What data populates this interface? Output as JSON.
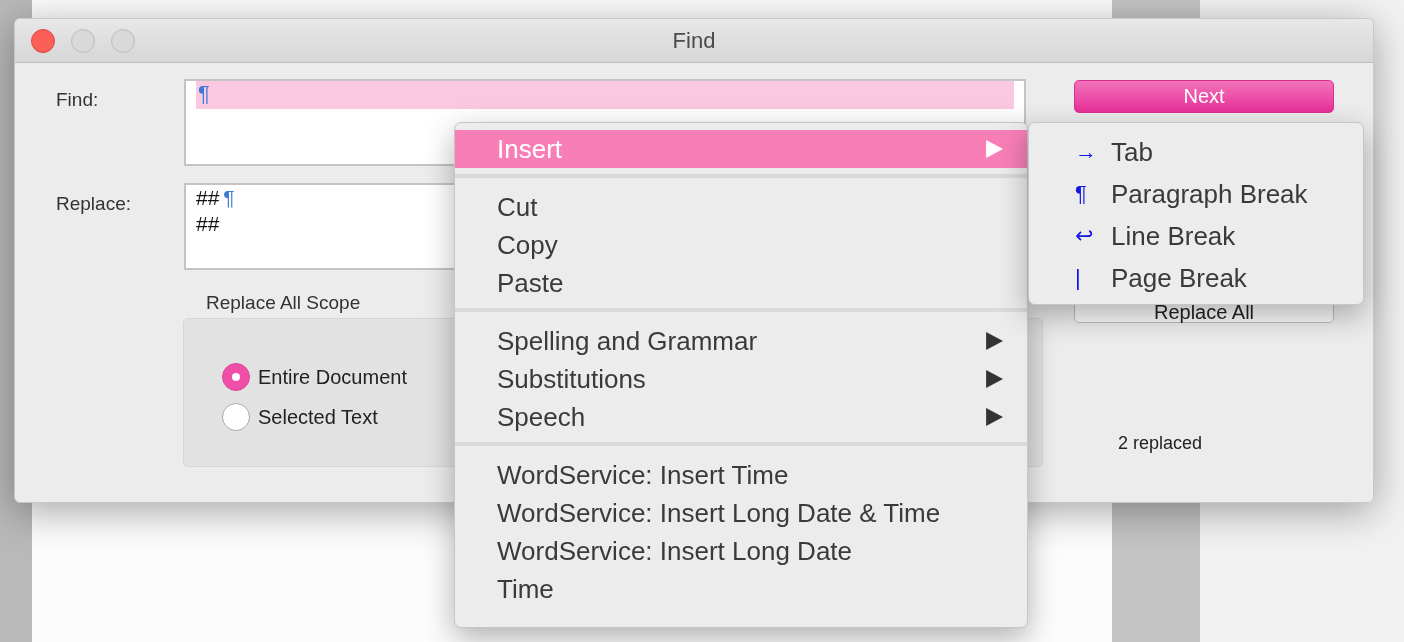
{
  "window": {
    "title": "Find"
  },
  "find": {
    "label": "Find:",
    "value": "¶",
    "selected": true
  },
  "replace": {
    "label": "Replace:",
    "lines": [
      {
        "text": "##",
        "mark": "¶"
      },
      {
        "text": "##"
      }
    ]
  },
  "scope": {
    "title": "Replace All Scope",
    "options": [
      {
        "label": "Entire Document",
        "selected": true
      },
      {
        "label": "Selected Text",
        "selected": false
      }
    ]
  },
  "buttons": [
    {
      "label": "Next",
      "kind": "default"
    },
    {
      "label": "Replace All",
      "kind": "plain"
    }
  ],
  "status": "2 replaced",
  "context_menu": {
    "sections": [
      [
        {
          "label": "Insert",
          "submenu": true,
          "highlighted": true
        }
      ],
      [
        {
          "label": "Cut",
          "submenu": false,
          "highlighted": false
        },
        {
          "label": "Copy",
          "submenu": false,
          "highlighted": false
        },
        {
          "label": "Paste",
          "submenu": false,
          "highlighted": false
        }
      ],
      [
        {
          "label": "Spelling and Grammar",
          "submenu": true,
          "highlighted": false
        },
        {
          "label": "Substitutions",
          "submenu": true,
          "highlighted": false
        },
        {
          "label": "Speech",
          "submenu": true,
          "highlighted": false
        }
      ],
      [
        {
          "label": "WordService: Insert Time",
          "submenu": false,
          "highlighted": false
        },
        {
          "label": "WordService: Insert Long Date & Time",
          "submenu": false,
          "highlighted": false
        },
        {
          "label": "WordService: Insert Long Date",
          "submenu": false,
          "highlighted": false
        },
        {
          "label": "Time",
          "submenu": false,
          "highlighted": false
        }
      ]
    ]
  },
  "submenu": {
    "items": [
      {
        "symbol": "→",
        "label": "Tab"
      },
      {
        "symbol": "¶",
        "label": "Paragraph Break"
      },
      {
        "symbol": "↩",
        "label": "Line Break"
      },
      {
        "symbol": "|",
        "label": "Page Break"
      }
    ]
  }
}
